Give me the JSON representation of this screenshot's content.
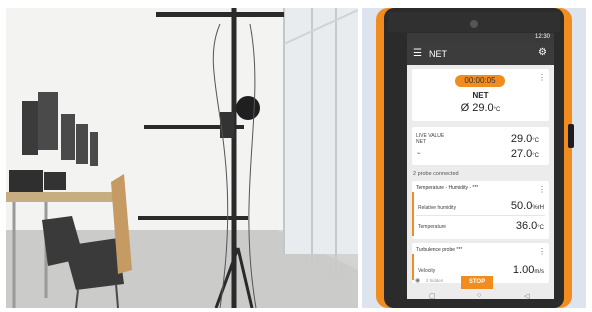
{
  "device_screen": {
    "status_time": "12:30",
    "app_title": "NET",
    "timer": "00:00:05",
    "mode": "NET",
    "average": "Ø 29.0",
    "average_unit": "°C",
    "live_value_label": "LIVE VALUE",
    "live_value_sublabel": "NET",
    "live_value_1": "29.0",
    "live_value_1_unit": "°C",
    "live_value_2": "27.0",
    "live_value_2_unit": "°C",
    "probes_connected": "2 probe connected",
    "probe1_name": "Temperature - Humidity - ***",
    "humidity_label": "Relative humidity",
    "humidity_value": "50.0",
    "humidity_unit": "%rH",
    "temperature_label": "Temperature",
    "temperature_value": "36.0",
    "temperature_unit": "°C",
    "probe2_name": "Turbulence probe ***",
    "velocity_label": "Velocity",
    "velocity_value": "1.00",
    "velocity_unit": "m/s",
    "hidden_label": "2 hidden",
    "stop_label": "STOP"
  },
  "colors": {
    "accent_orange": "#f28c1e",
    "device_body": "#2b2b2b",
    "app_bar": "#3c3c3c"
  }
}
